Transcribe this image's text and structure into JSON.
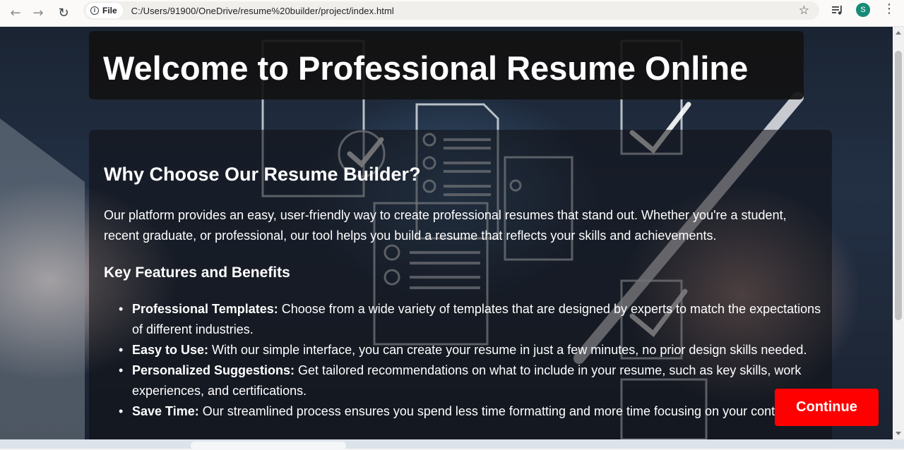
{
  "browser": {
    "back_icon": "arrow-left-icon",
    "forward_icon": "arrow-right-icon",
    "reload_icon": "reload-icon",
    "site_chip_label": "File",
    "url": "C:/Users/91900/OneDrive/resume%20builder/project/index.html",
    "profile_initial": "S",
    "profile_color": "#168b77"
  },
  "hero": {
    "title": "Welcome to Professional Resume Online"
  },
  "main": {
    "heading": "Why Choose Our Resume Builder?",
    "intro": "Our platform provides an easy, user-friendly way to create professional resumes that stand out. Whether you're a student, recent graduate, or professional, our tool helps you build a resume that reflects your skills and achievements.",
    "features_heading": "Key Features and Benefits",
    "features": [
      {
        "term": "Professional Templates:",
        "text": " Choose from a wide variety of templates that are designed by experts to match the expectations of different industries."
      },
      {
        "term": "Easy to Use:",
        "text": " With our simple interface, you can create your resume in just a few minutes, no prior design skills needed."
      },
      {
        "term": "Personalized Suggestions:",
        "text": " Get tailored recommendations on what to include in your resume, such as key skills, work experiences, and certifications."
      },
      {
        "term": "Save Time:",
        "text": " Our streamlined process ensures you spend less time formatting and more time focusing on your content."
      }
    ]
  },
  "actions": {
    "continue_label": "Continue",
    "continue_color": "#ff0000"
  }
}
